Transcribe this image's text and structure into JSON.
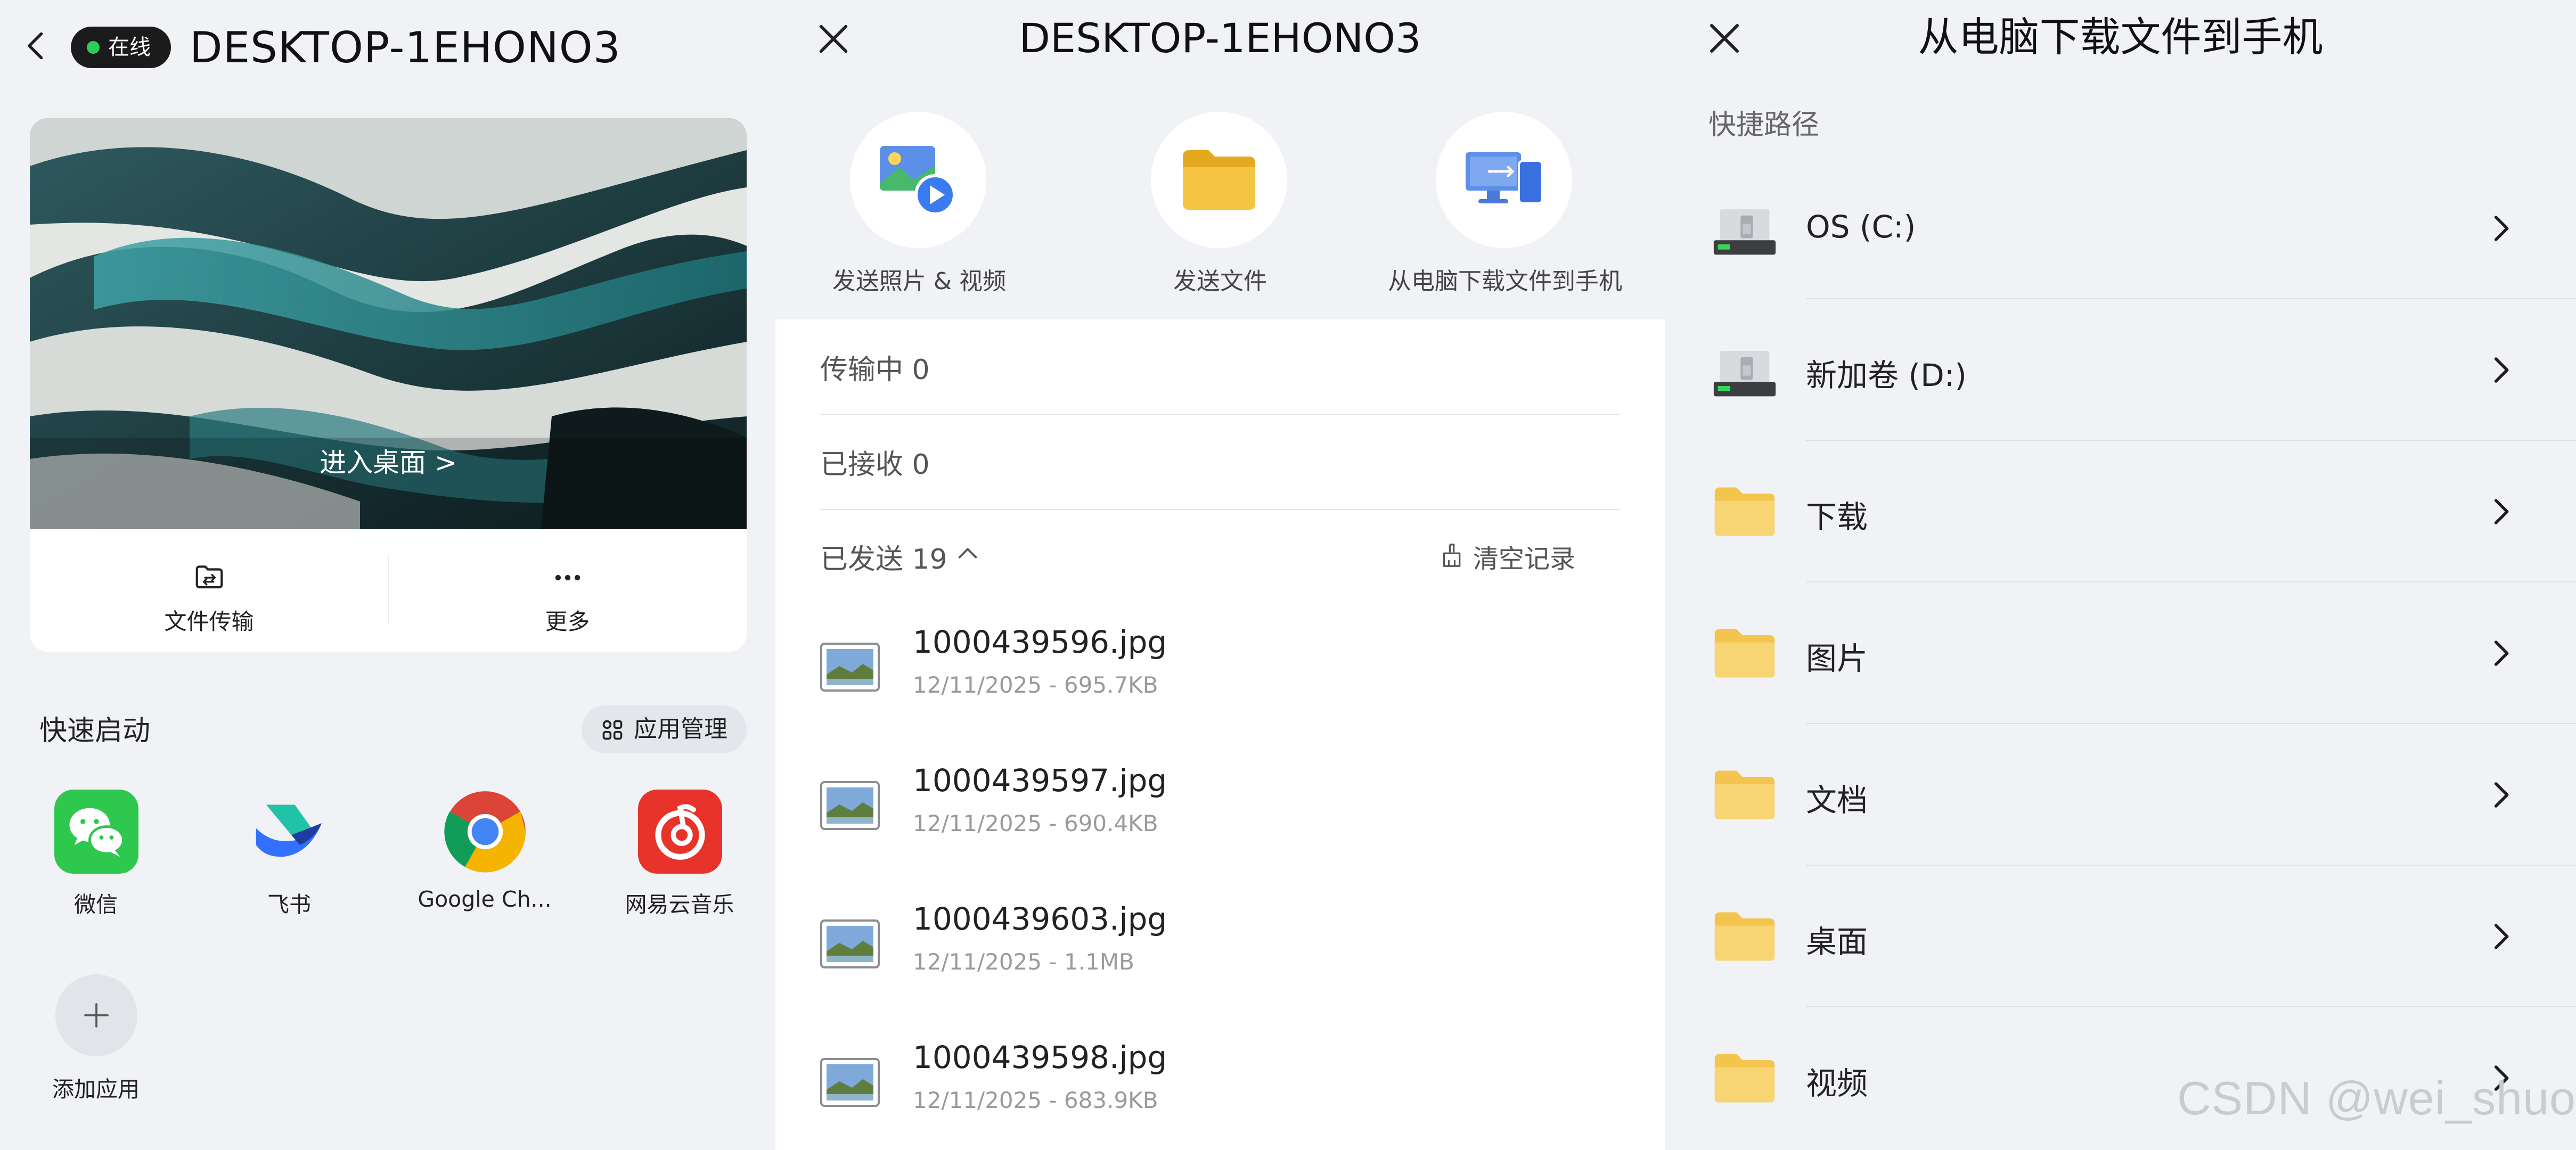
{
  "panel1": {
    "status_badge": "在线",
    "device_name": "DESKTOP-1EHONO3",
    "enter_desktop": "进入桌面 >",
    "actions": [
      {
        "label": "文件传输",
        "icon": "folder-transfer-icon"
      },
      {
        "label": "更多",
        "icon": "more-icon"
      }
    ],
    "quick_launch_title": "快速启动",
    "app_manage_label": "应用管理",
    "apps": [
      {
        "label": "微信",
        "icon": "wechat-icon"
      },
      {
        "label": "飞书",
        "icon": "feishu-icon"
      },
      {
        "label": "Google Ch...",
        "icon": "chrome-icon"
      },
      {
        "label": "网易云音乐",
        "icon": "netease-music-icon"
      }
    ],
    "add_app_label": "添加应用"
  },
  "panel2": {
    "title": "DESKTOP-1EHONO3",
    "actions": [
      {
        "label": "发送照片 & 视频",
        "icon": "photo-video-icon"
      },
      {
        "label": "发送文件",
        "icon": "folder-icon"
      },
      {
        "label": "从电脑下载文件到手机",
        "icon": "pc-to-phone-icon"
      }
    ],
    "transferring": "传输中 0",
    "received": "已接收 0",
    "sent": "已发送 19",
    "clear_label": "清空记录",
    "files": [
      {
        "name": "1000439596.jpg",
        "meta": "12/11/2025 - 695.7KB"
      },
      {
        "name": "1000439597.jpg",
        "meta": "12/11/2025 - 690.4KB"
      },
      {
        "name": "1000439603.jpg",
        "meta": "12/11/2025 - 1.1MB"
      },
      {
        "name": "1000439598.jpg",
        "meta": "12/11/2025 - 683.9KB"
      }
    ]
  },
  "panel3": {
    "title": "从电脑下载文件到手机",
    "section_label": "快捷路径",
    "paths": [
      {
        "label": "OS (C:)",
        "icon": "drive-icon"
      },
      {
        "label": "新加卷 (D:)",
        "icon": "drive-icon"
      },
      {
        "label": "下载",
        "icon": "folder-icon"
      },
      {
        "label": "图片",
        "icon": "folder-icon"
      },
      {
        "label": "文档",
        "icon": "folder-icon"
      },
      {
        "label": "桌面",
        "icon": "folder-icon"
      },
      {
        "label": "视频",
        "icon": "folder-icon"
      }
    ]
  },
  "watermark": "CSDN @wei_shuo",
  "colors": {
    "background": "#f0f2f5",
    "online_dot": "#2bcc5a",
    "folder_yellow": "#f5c443",
    "accent_blue": "#3a7bf0"
  }
}
